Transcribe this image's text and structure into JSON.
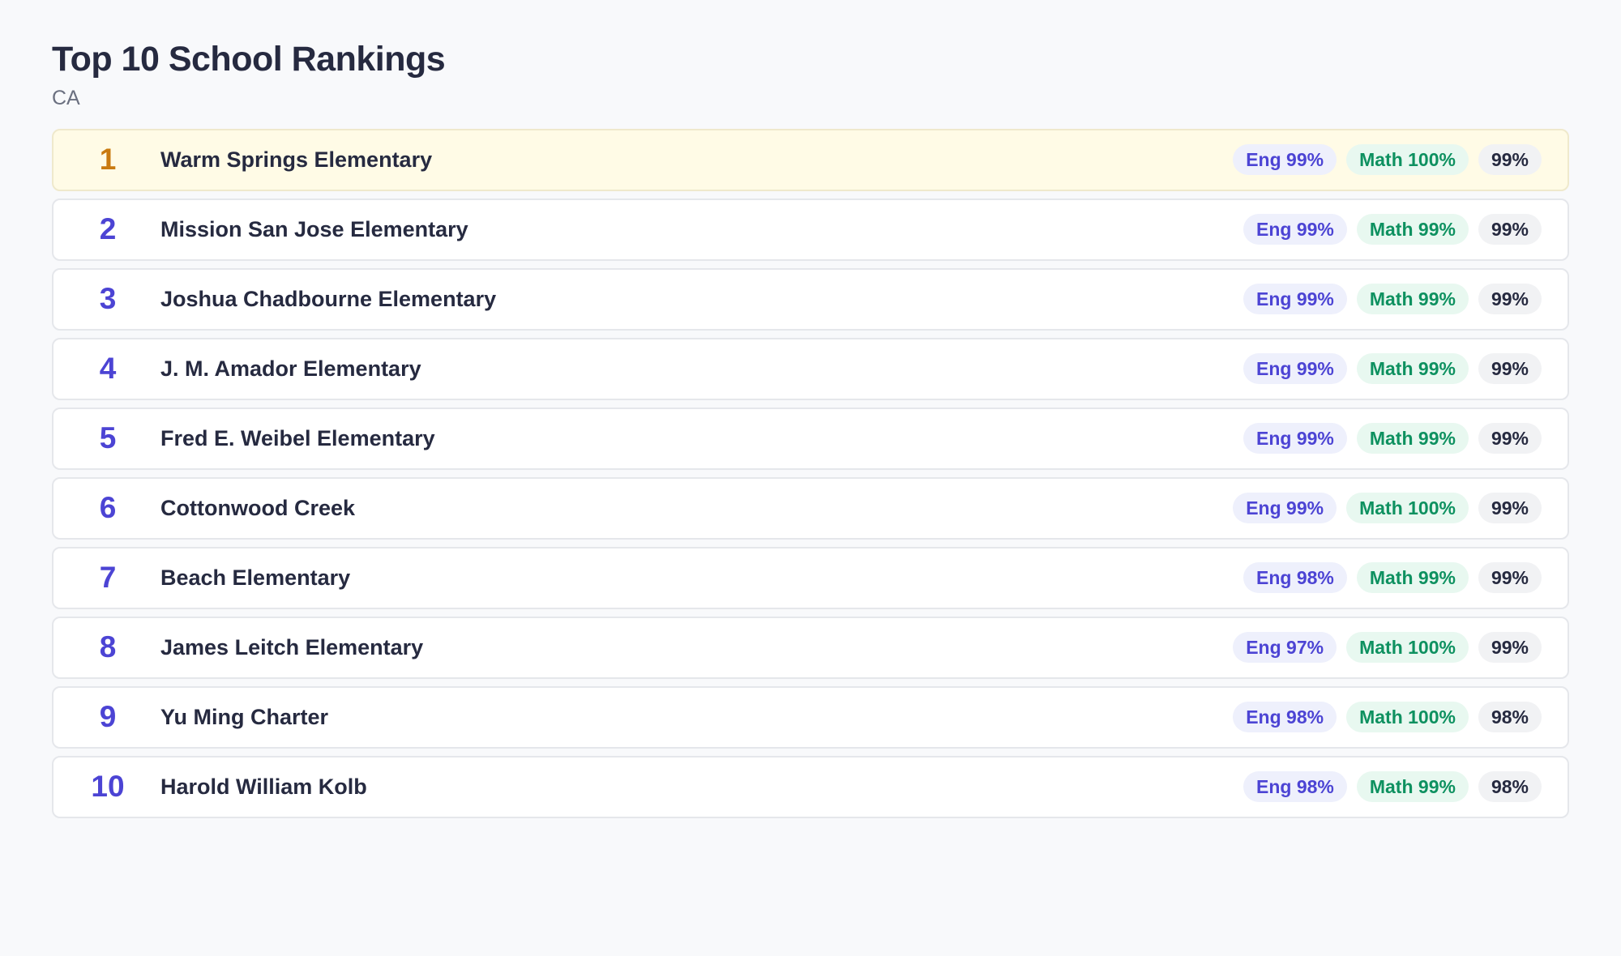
{
  "header": {
    "title": "Top 10 School Rankings",
    "subtitle": "CA"
  },
  "colors": {
    "background": "#f8f9fb",
    "text": "#262a40",
    "rank_default": "#4c44d4",
    "rank_first": "#c97a10",
    "first_row_bg": "#fffbe6",
    "eng_badge_bg": "#eef0fc",
    "eng_badge_text": "#4c44d4",
    "math_badge_bg": "#e8f8f0",
    "math_badge_text": "#0e9160",
    "overall_badge_bg": "#f1f2f4"
  },
  "rankings": [
    {
      "rank": "1",
      "name": "Warm Springs Elementary",
      "eng": "Eng 99%",
      "math": "Math 100%",
      "overall": "99%"
    },
    {
      "rank": "2",
      "name": "Mission San Jose Elementary",
      "eng": "Eng 99%",
      "math": "Math 99%",
      "overall": "99%"
    },
    {
      "rank": "3",
      "name": "Joshua Chadbourne Elementary",
      "eng": "Eng 99%",
      "math": "Math 99%",
      "overall": "99%"
    },
    {
      "rank": "4",
      "name": "J. M. Amador Elementary",
      "eng": "Eng 99%",
      "math": "Math 99%",
      "overall": "99%"
    },
    {
      "rank": "5",
      "name": "Fred E. Weibel Elementary",
      "eng": "Eng 99%",
      "math": "Math 99%",
      "overall": "99%"
    },
    {
      "rank": "6",
      "name": "Cottonwood Creek",
      "eng": "Eng 99%",
      "math": "Math 100%",
      "overall": "99%"
    },
    {
      "rank": "7",
      "name": "Beach Elementary",
      "eng": "Eng 98%",
      "math": "Math 99%",
      "overall": "99%"
    },
    {
      "rank": "8",
      "name": "James Leitch Elementary",
      "eng": "Eng 97%",
      "math": "Math 100%",
      "overall": "99%"
    },
    {
      "rank": "9",
      "name": "Yu Ming Charter",
      "eng": "Eng 98%",
      "math": "Math 100%",
      "overall": "98%"
    },
    {
      "rank": "10",
      "name": "Harold William Kolb",
      "eng": "Eng 98%",
      "math": "Math 99%",
      "overall": "98%"
    }
  ]
}
